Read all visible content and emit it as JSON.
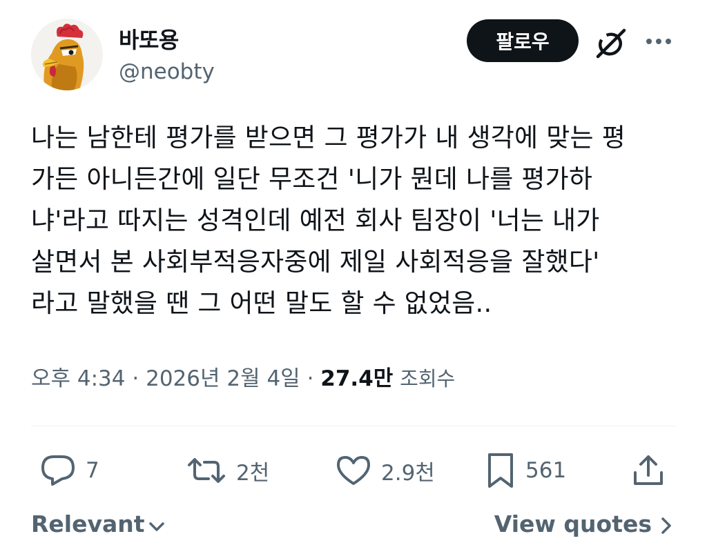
{
  "author": {
    "display_name": "바또용",
    "handle": "@neobty",
    "avatar_icon": "rooster-avatar"
  },
  "header": {
    "follow_label": "팔로우",
    "grok_icon": "grok-icon",
    "more_icon": "more-icon"
  },
  "tweet": {
    "lines": [
      "나는 남한테 평가를 받으면 그 평가가 내 생각에 맞는 평",
      "가든 아니든간에 일단 무조건 '니가 뭔데 나를 평가하",
      "냐'라고 따지는 성격인데 예전 회사 팀장이 '너는 내가",
      "살면서 본 사회부적응자중에 제일 사회적응을 잘했다'",
      "라고 말했을 땐 그 어떤 말도 할 수 없었음.."
    ]
  },
  "meta": {
    "time": "오후 4:34",
    "separator": "·",
    "date": "2026년 2월 4일",
    "views_count": "27.4만",
    "views_label": "조회수"
  },
  "actions": {
    "reply_count": "7",
    "repost_count": "2천",
    "like_count": "2.9천",
    "bookmark_count": "561",
    "icons": [
      "reply-icon",
      "repost-icon",
      "like-icon",
      "bookmark-icon",
      "share-icon"
    ]
  },
  "footer": {
    "sort_label": "Relevant",
    "quotes_label": "View quotes"
  },
  "colors": {
    "text": "#0f1419",
    "secondary": "#536471",
    "follow_bg": "#0f1419",
    "divider": "#eff3f4"
  }
}
